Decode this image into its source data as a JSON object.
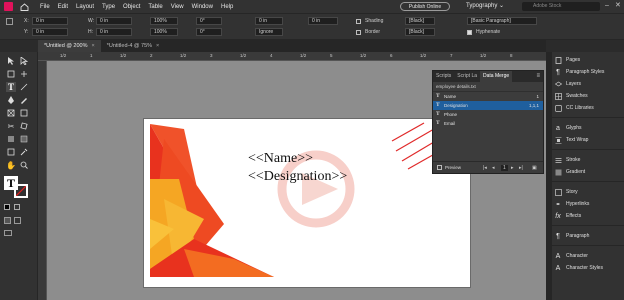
{
  "menu": {
    "items": [
      "File",
      "Edit",
      "Layout",
      "Type",
      "Object",
      "Table",
      "View",
      "Window",
      "Help"
    ],
    "publish_label": "Publish Online",
    "workspace": "Typography",
    "search_placeholder": "Adobe Stock"
  },
  "control": {
    "x_val": "0 in",
    "w_val": "0 in",
    "y_val": "0 in",
    "h_val": "0 in",
    "pct1": "100%",
    "pct2": "100%",
    "angle1": "0°",
    "angle2": "0°",
    "stroke_val": "0 in",
    "stroke_type": "Ignore",
    "shading_label": "Shading",
    "border_label": "Border",
    "color1": "[Black]",
    "color2": "[Black]",
    "paragraph_style": "[Basic Paragraph]",
    "hyphenate_label": "Hyphenate",
    "size_val": "0 in"
  },
  "tabs": [
    {
      "label": "*Untitled @ 200%"
    },
    {
      "label": "*Untitled-4 @ 75%"
    }
  ],
  "ruler": {
    "labels": [
      "1/2",
      "1",
      "1/2",
      "2",
      "1/2",
      "3",
      "1/2",
      "4",
      "1/2",
      "5",
      "1/2",
      "6",
      "1/2",
      "7",
      "1/2",
      "8"
    ]
  },
  "card": {
    "name": "<<Name>>",
    "designation": "<<Designation>>"
  },
  "data_merge": {
    "tabs": [
      "Scripts",
      "Script La",
      "Data Merge"
    ],
    "source": "employee details.txt",
    "fields": [
      {
        "label": "Name",
        "ref": "1",
        "selected": false
      },
      {
        "label": "Designation",
        "ref": "1,1,1",
        "selected": true
      },
      {
        "label": "Phone",
        "ref": "",
        "selected": false
      },
      {
        "label": "Email",
        "ref": "",
        "selected": false
      }
    ],
    "preview_label": "Preview",
    "record_num": "1"
  },
  "right_panel": {
    "items": [
      "Pages",
      "Paragraph Styles",
      "Layers",
      "Swatches",
      "CC Libraries",
      "Glyphs",
      "Text Wrap",
      "Stroke",
      "Gradient",
      "Story",
      "Hyperlinks",
      "Effects",
      "Paragraph",
      "Character",
      "Character Styles"
    ]
  },
  "colors": {
    "accent_blue": "#1f5f9e",
    "indesign_pink": "#e0125b",
    "card_red": "#e8321e",
    "card_orange": "#f5a623"
  }
}
